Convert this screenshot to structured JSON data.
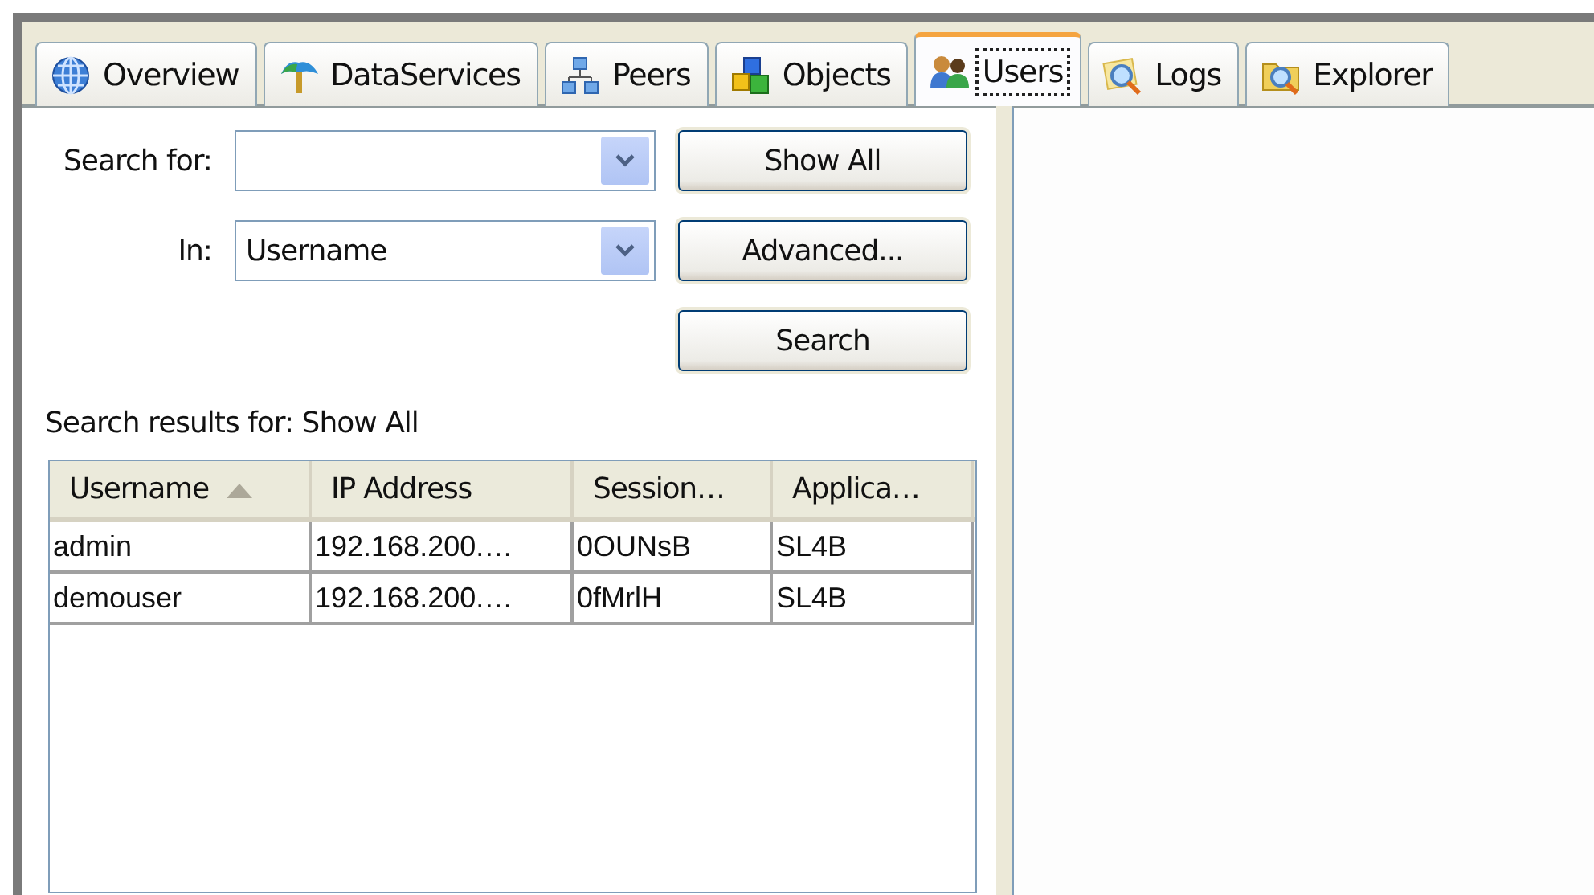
{
  "tabs": [
    {
      "label": "Overview",
      "selected": false
    },
    {
      "label": "DataServices",
      "selected": false
    },
    {
      "label": "Peers",
      "selected": false
    },
    {
      "label": "Objects",
      "selected": false
    },
    {
      "label": "Users",
      "selected": true
    },
    {
      "label": "Logs",
      "selected": false
    },
    {
      "label": "Explorer",
      "selected": false
    }
  ],
  "search": {
    "search_for_label": "Search for:",
    "in_label": "In:",
    "in_value": "Username"
  },
  "buttons": [
    "Show All",
    "Advanced...",
    "Search"
  ],
  "results_label": "Search results for: Show All",
  "table": {
    "columns": [
      {
        "label": "Username",
        "sorted": true
      },
      {
        "label": "IP Address",
        "sorted": false
      },
      {
        "label": "Session…",
        "sorted": false
      },
      {
        "label": "Applica…",
        "sorted": false
      }
    ],
    "rows": [
      [
        "admin",
        "192.168.200.…",
        "0OUNsB",
        "SL4B"
      ],
      [
        "demouser",
        "192.168.200.…",
        "0fMrlH",
        "SL4B"
      ]
    ]
  }
}
